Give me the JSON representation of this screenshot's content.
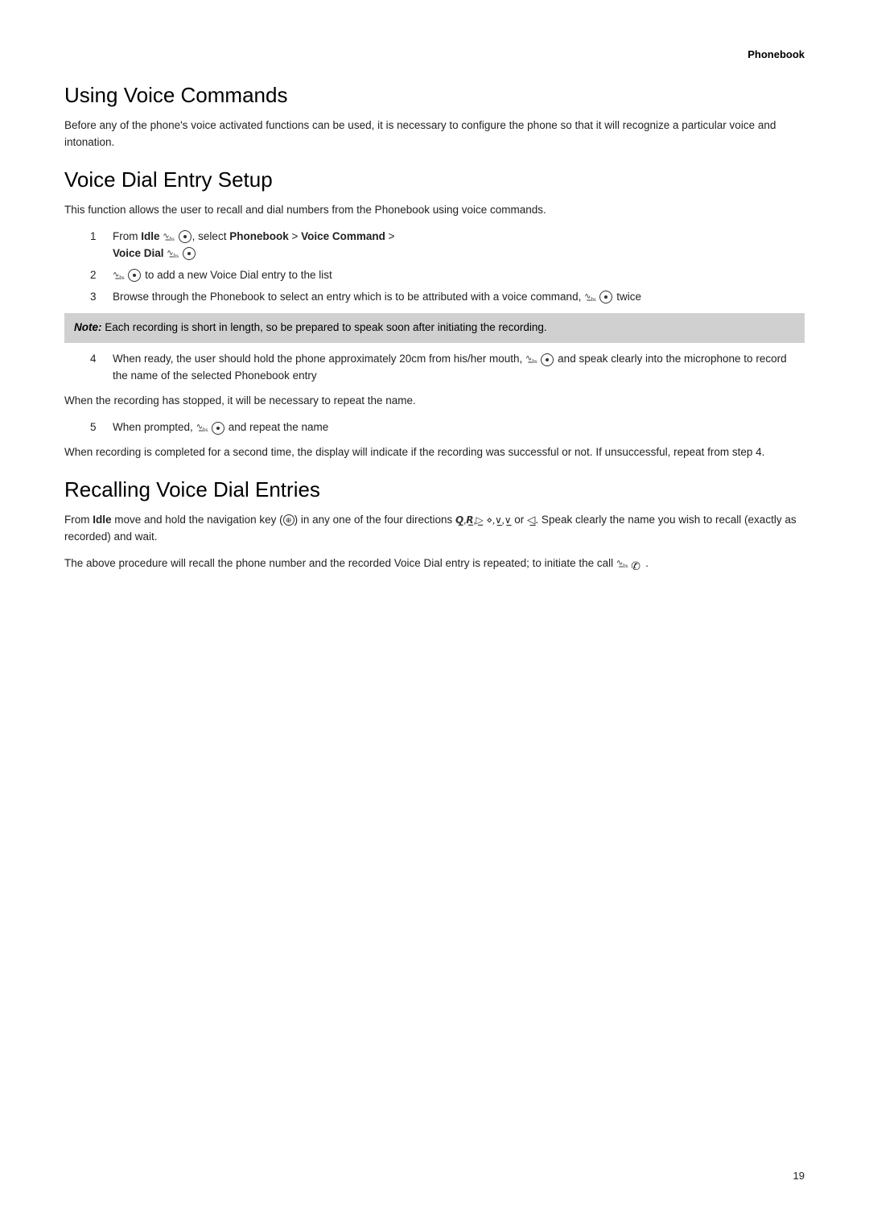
{
  "header": {
    "section_label": "Phonebook"
  },
  "page_number": "19",
  "sections": [
    {
      "id": "using-voice-commands",
      "title": "Using Voice Commands",
      "intro": "Before any of the phone's voice activated functions can be used, it is necessary to configure the phone so that it will recognize a particular voice and intonation."
    },
    {
      "id": "voice-dial-entry-setup",
      "title": "Voice Dial Entry Setup",
      "intro": "This function allows the user to recall and dial numbers from the Phonebook using voice commands.",
      "steps": [
        {
          "num": "1",
          "text_parts": [
            {
              "type": "text",
              "content": "From "
            },
            {
              "type": "bold",
              "content": "Idle"
            },
            {
              "type": "text",
              "content": " "
            },
            {
              "type": "icon",
              "name": "signal-icon-1"
            },
            {
              "type": "text",
              "content": " "
            },
            {
              "type": "icon",
              "name": "circle-dot-icon-1"
            },
            {
              "type": "text",
              "content": ", select "
            },
            {
              "type": "bold",
              "content": "Phonebook"
            },
            {
              "type": "text",
              "content": " > "
            },
            {
              "type": "bold",
              "content": "Voice Command"
            },
            {
              "type": "text",
              "content": " > "
            },
            {
              "type": "bold",
              "content": "Voice Dial"
            },
            {
              "type": "text",
              "content": " "
            },
            {
              "type": "icon",
              "name": "signal-icon-2"
            },
            {
              "type": "text",
              "content": " "
            },
            {
              "type": "icon",
              "name": "circle-dot-icon-2"
            }
          ],
          "plain": "From Idle [signal] [●], select Phonebook > Voice Command > Voice Dial [signal] [●]"
        },
        {
          "num": "2",
          "plain": "[signal] [●] to add a new Voice Dial entry to the list"
        },
        {
          "num": "3",
          "plain": "Browse through the Phonebook to select an entry which is to be attributed with a voice command, [signal] [●] twice"
        }
      ],
      "note": "Each recording is short in length, so be prepared to speak soon after initiating the recording.",
      "steps_continued": [
        {
          "num": "4",
          "plain": "When ready, the user should hold the phone approximately 20cm from his/her mouth, [signal] [●] and speak clearly into the microphone to record the name of the selected Phonebook entry"
        }
      ],
      "between_text": "When the recording has stopped, it will be necessary to repeat the name.",
      "step5": {
        "num": "5",
        "plain": "When prompted, [signal] [●] and repeat the name"
      },
      "after_text": "When recording is completed for a second time, the display will indicate if the recording was successful or not. If unsuccessful, repeat from step 4."
    },
    {
      "id": "recalling-voice-dial",
      "title": "Recalling Voice Dial Entries",
      "para1": "From Idle move and hold the navigation key ([nav]) in any one of the four directions [up],[down],[right] or [left]. Speak clearly the name you wish to recall (exactly as recorded) and wait.",
      "para2": "The above procedure will recall the phone number and the recorded Voice Dial entry is repeated; to initiate the call [signal] [phone]."
    }
  ]
}
